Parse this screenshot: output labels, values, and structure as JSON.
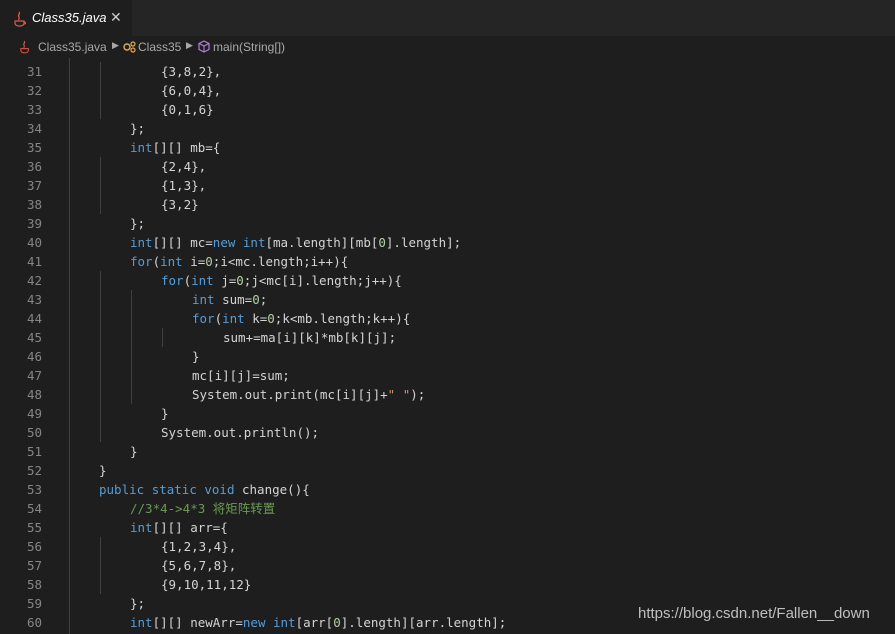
{
  "tab": {
    "filename": "Class35.java",
    "close_glyph": "✕",
    "icon": "java-file-icon"
  },
  "breadcrumb": {
    "file": "Class35.java",
    "class_name": "Class35",
    "method": "main(String[])"
  },
  "code_lines": [
    {
      "n": "31",
      "indent": 2,
      "tokens": [
        [
          "",
          "{3,8,2},"
        ]
      ]
    },
    {
      "n": "32",
      "indent": 2,
      "tokens": [
        [
          "",
          "{6,0,4},"
        ]
      ]
    },
    {
      "n": "33",
      "indent": 2,
      "tokens": [
        [
          "",
          "{0,1,6}"
        ]
      ]
    },
    {
      "n": "34",
      "indent": 1,
      "tokens": [
        [
          "",
          "};"
        ]
      ]
    },
    {
      "n": "35",
      "indent": 1,
      "tokens": [
        [
          "kw",
          "int"
        ],
        [
          "",
          "[][] mb={"
        ]
      ]
    },
    {
      "n": "36",
      "indent": 2,
      "tokens": [
        [
          "",
          "{2,4},"
        ]
      ]
    },
    {
      "n": "37",
      "indent": 2,
      "tokens": [
        [
          "",
          "{1,3},"
        ]
      ]
    },
    {
      "n": "38",
      "indent": 2,
      "tokens": [
        [
          "",
          "{3,2}"
        ]
      ]
    },
    {
      "n": "39",
      "indent": 1,
      "tokens": [
        [
          "",
          "};"
        ]
      ]
    },
    {
      "n": "40",
      "indent": 1,
      "tokens": [
        [
          "kw",
          "int"
        ],
        [
          "",
          "[][] mc="
        ],
        [
          "kw",
          "new"
        ],
        [
          "",
          " "
        ],
        [
          "kw",
          "int"
        ],
        [
          "",
          "[ma.length][mb["
        ],
        [
          "num",
          "0"
        ],
        [
          "",
          "].length];"
        ]
      ]
    },
    {
      "n": "41",
      "indent": 1,
      "tokens": [
        [
          "kw",
          "for"
        ],
        [
          "",
          "("
        ],
        [
          "kw",
          "int"
        ],
        [
          "",
          " i="
        ],
        [
          "num",
          "0"
        ],
        [
          "",
          ";i<mc.length;i++){"
        ]
      ]
    },
    {
      "n": "42",
      "indent": 2,
      "tokens": [
        [
          "kw",
          "for"
        ],
        [
          "",
          "("
        ],
        [
          "kw",
          "int"
        ],
        [
          "",
          " j="
        ],
        [
          "num",
          "0"
        ],
        [
          "",
          ";j<mc[i].length;j++){"
        ]
      ]
    },
    {
      "n": "43",
      "indent": 3,
      "tokens": [
        [
          "kw",
          "int"
        ],
        [
          "",
          " sum="
        ],
        [
          "num",
          "0"
        ],
        [
          "",
          ";"
        ]
      ]
    },
    {
      "n": "44",
      "indent": 3,
      "tokens": [
        [
          "kw",
          "for"
        ],
        [
          "",
          "("
        ],
        [
          "kw",
          "int"
        ],
        [
          "",
          " k="
        ],
        [
          "num",
          "0"
        ],
        [
          "",
          ";k<mb.length;k++){"
        ]
      ]
    },
    {
      "n": "45",
      "indent": 4,
      "tokens": [
        [
          "",
          "sum+=ma[i][k]*mb[k][j];"
        ]
      ]
    },
    {
      "n": "46",
      "indent": 3,
      "tokens": [
        [
          "",
          "}"
        ]
      ]
    },
    {
      "n": "47",
      "indent": 3,
      "tokens": [
        [
          "",
          "mc[i][j]=sum;"
        ]
      ]
    },
    {
      "n": "48",
      "indent": 3,
      "tokens": [
        [
          "",
          "System.out.print(mc[i][j]+"
        ],
        [
          "str",
          "\" \""
        ],
        [
          "",
          ");"
        ]
      ]
    },
    {
      "n": "49",
      "indent": 2,
      "tokens": [
        [
          "",
          "}"
        ]
      ]
    },
    {
      "n": "50",
      "indent": 2,
      "tokens": [
        [
          "",
          "System.out.println();"
        ]
      ]
    },
    {
      "n": "51",
      "indent": 1,
      "tokens": [
        [
          "",
          "}"
        ]
      ]
    },
    {
      "n": "52",
      "indent": 0,
      "tokens": [
        [
          "",
          "}"
        ]
      ]
    },
    {
      "n": "53",
      "indent": 0,
      "tokens": [
        [
          "kw",
          "public"
        ],
        [
          "",
          " "
        ],
        [
          "kw",
          "static"
        ],
        [
          "",
          " "
        ],
        [
          "kw",
          "void"
        ],
        [
          "",
          " change(){"
        ]
      ]
    },
    {
      "n": "54",
      "indent": 1,
      "tokens": [
        [
          "com",
          "//3*4->4*3 将矩阵转置"
        ]
      ]
    },
    {
      "n": "55",
      "indent": 1,
      "tokens": [
        [
          "kw",
          "int"
        ],
        [
          "",
          "[][] arr={"
        ]
      ]
    },
    {
      "n": "56",
      "indent": 2,
      "tokens": [
        [
          "",
          "{1,2,3,4},"
        ]
      ]
    },
    {
      "n": "57",
      "indent": 2,
      "tokens": [
        [
          "",
          "{5,6,7,8},"
        ]
      ]
    },
    {
      "n": "58",
      "indent": 2,
      "tokens": [
        [
          "",
          "{9,10,11,12}"
        ]
      ]
    },
    {
      "n": "59",
      "indent": 1,
      "tokens": [
        [
          "",
          "};"
        ]
      ]
    },
    {
      "n": "60",
      "indent": 1,
      "tokens": [
        [
          "kw",
          "int"
        ],
        [
          "",
          "[][] newArr="
        ],
        [
          "kw",
          "new"
        ],
        [
          "",
          " "
        ],
        [
          "kw",
          "int"
        ],
        [
          "",
          "[arr["
        ],
        [
          "num",
          "0"
        ],
        [
          "",
          "].length][arr.length];"
        ]
      ]
    }
  ],
  "watermark": "https://blog.csdn.net/Fallen__down",
  "colors": {
    "background": "#1e1e1e",
    "keyword": "#569cd6",
    "number": "#b5cea8",
    "string": "#ce9178",
    "comment": "#6a9955",
    "text": "#d4d4d4"
  }
}
